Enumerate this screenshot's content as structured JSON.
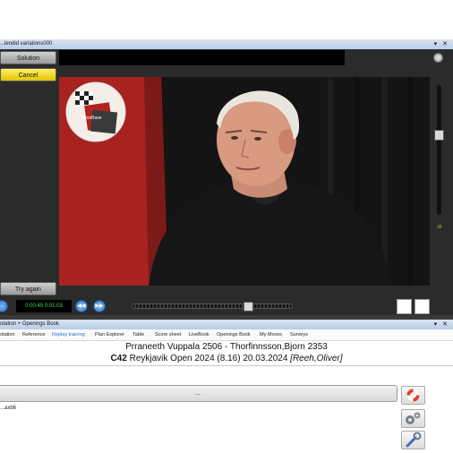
{
  "video_pane": {
    "title": "...lendid variations000",
    "title_buttons": "▾ ✕",
    "solution_label": "Solution",
    "cancel_label": "Cancel",
    "try_again_label": "Try again",
    "timecode": "0:00:45 0:01:03",
    "volume_level": "38",
    "seek_progress": 0.74,
    "logo_text": "ChessBase"
  },
  "notation_pane": {
    "title": "otation + Openings Book",
    "title_buttons": "▾ ✕",
    "tabs": [
      {
        "label": "otation",
        "active": false
      },
      {
        "label": "Reference",
        "active": false
      },
      {
        "label": "Replay training",
        "active": true
      },
      {
        "label": "Plan Explorer",
        "active": false
      },
      {
        "label": "Table",
        "active": false
      },
      {
        "label": "Score sheet",
        "active": false
      },
      {
        "label": "LiveBook",
        "active": false
      },
      {
        "label": "Openings Book",
        "active": false
      },
      {
        "label": "My Moves",
        "active": false
      },
      {
        "label": "Surveys",
        "active": false
      }
    ],
    "game_header": {
      "white": "Prraneeth Vuppala",
      "white_elo": "2506",
      "separator": " - ",
      "black": "Thorfinnsson,Bjorn",
      "black_elo": "2353",
      "eco": "C42",
      "event": "Reykjavik Open 2024 (8.16) 20.03.2024",
      "annotator": "[Reeh,Oliver]"
    },
    "move_bar_label": "...",
    "moves_text": "...axb6"
  },
  "colors": {
    "cancel_bg": "#f4dc1e",
    "timecode_text": "#41e04a",
    "active_tab": "#2a73c7",
    "pane_dark": "#2b2b2b"
  },
  "icons": [
    "play-icon",
    "rewind-icon",
    "forward-icon",
    "pin-icon",
    "lifebuoy-icon",
    "gears-icon",
    "wrench-icon",
    "chessbase-logo"
  ]
}
